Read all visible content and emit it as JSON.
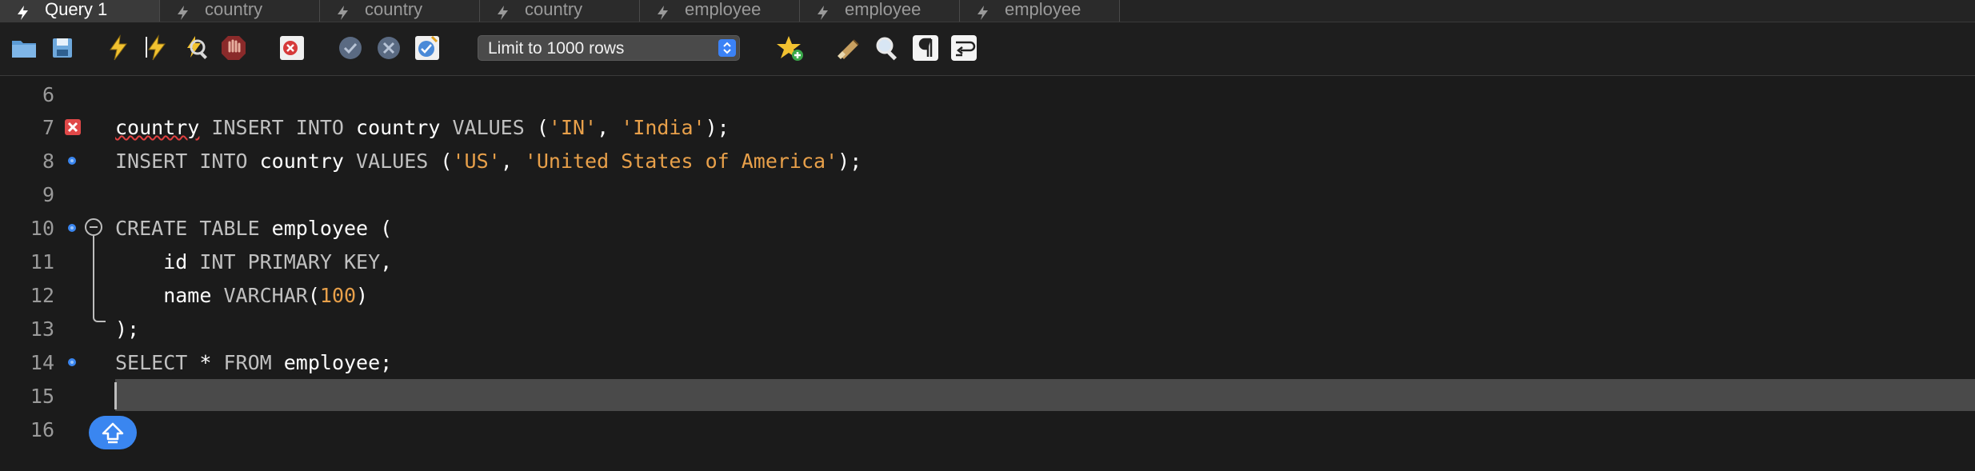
{
  "tabs": [
    {
      "label": "Query 1",
      "active": true
    },
    {
      "label": "country",
      "active": false
    },
    {
      "label": "country",
      "active": false
    },
    {
      "label": "country",
      "active": false
    },
    {
      "label": "employee",
      "active": false
    },
    {
      "label": "employee",
      "active": false
    },
    {
      "label": "employee",
      "active": false
    }
  ],
  "toolbar": {
    "limit_select_value": "Limit to 1000 rows",
    "icons": [
      "open-folder-icon",
      "save-icon",
      "execute-icon",
      "execute-current-icon",
      "explain-icon",
      "stop-icon",
      "toggle-error-stop-icon",
      "commit-icon",
      "rollback-icon",
      "autocommit-icon",
      "add-snippet-icon",
      "beautify-icon",
      "find-icon",
      "invisible-chars-icon",
      "word-wrap-icon"
    ]
  },
  "editor": {
    "lines": [
      {
        "num": "6"
      },
      {
        "num": "7",
        "marker": "error",
        "tokens": [
          {
            "t": "country",
            "c": "err"
          },
          {
            "t": " "
          },
          {
            "t": "INSERT INTO",
            "c": "kw"
          },
          {
            "t": " country "
          },
          {
            "t": "VALUES",
            "c": "kw"
          },
          {
            "t": " ("
          },
          {
            "t": "'IN'",
            "c": "str"
          },
          {
            "t": ", "
          },
          {
            "t": "'India'",
            "c": "str"
          },
          {
            "t": ");"
          }
        ]
      },
      {
        "num": "8",
        "marker": "dot",
        "tokens": [
          {
            "t": "INSERT INTO",
            "c": "kw"
          },
          {
            "t": " country "
          },
          {
            "t": "VALUES",
            "c": "kw"
          },
          {
            "t": " ("
          },
          {
            "t": "'US'",
            "c": "str"
          },
          {
            "t": ", "
          },
          {
            "t": "'United States of America'",
            "c": "str"
          },
          {
            "t": ");"
          }
        ]
      },
      {
        "num": "9"
      },
      {
        "num": "10",
        "marker": "dot",
        "fold": "start",
        "tokens": [
          {
            "t": "CREATE TABLE",
            "c": "kw"
          },
          {
            "t": " employee ("
          }
        ]
      },
      {
        "num": "11",
        "tokens": [
          {
            "t": "    id "
          },
          {
            "t": "INT PRIMARY KEY",
            "c": "kw"
          },
          {
            "t": ","
          }
        ]
      },
      {
        "num": "12",
        "tokens": [
          {
            "t": "    name "
          },
          {
            "t": "VARCHAR",
            "c": "kw"
          },
          {
            "t": "("
          },
          {
            "t": "100",
            "c": "num"
          },
          {
            "t": ")"
          }
        ]
      },
      {
        "num": "13",
        "fold": "end",
        "tokens": [
          {
            "t": ");"
          }
        ]
      },
      {
        "num": "14",
        "marker": "dot",
        "tokens": [
          {
            "t": "SELECT",
            "c": "kw"
          },
          {
            "t": " * "
          },
          {
            "t": "FROM",
            "c": "kw"
          },
          {
            "t": " employee;"
          }
        ]
      },
      {
        "num": "15",
        "current": true
      },
      {
        "num": "16"
      }
    ]
  },
  "colors": {
    "keyword": "#c0c0c0",
    "string": "#e8a04a",
    "error": "#e04848",
    "accent": "#3a86f0"
  }
}
